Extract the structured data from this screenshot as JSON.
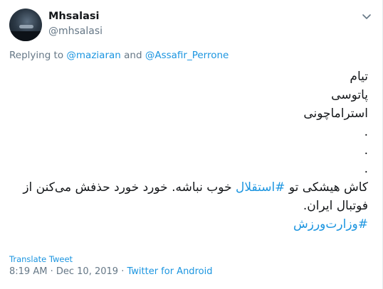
{
  "author": {
    "display_name": "Mhsalasi",
    "handle": "@mhsalasi"
  },
  "reply": {
    "prefix": "Replying to",
    "users": [
      "@maziaran",
      "@Assafir_Perrone"
    ],
    "joiner": "and"
  },
  "body": {
    "lines": [
      "تیام",
      "پاتوسی",
      "استراماچونی",
      ".",
      ".",
      "."
    ],
    "sentence_before": "کاش هیشکی تو ",
    "hashtag_1": "#استقلال",
    "sentence_after": " خوب نباشه. خورد خورد حذفش می‌کنن از فوتبال ایران.",
    "hashtag_2": "#وزارت‌ورزش"
  },
  "actions": {
    "translate_label": "Translate Tweet"
  },
  "meta": {
    "time": "8:19 AM",
    "separator": "·",
    "date": "Dec 10, 2019",
    "client": "Twitter for Android"
  },
  "colors": {
    "link": "#1b95e0",
    "secondary_text": "#657786",
    "text": "#14171a"
  },
  "icons": {
    "caret": "chevron-down-icon"
  }
}
